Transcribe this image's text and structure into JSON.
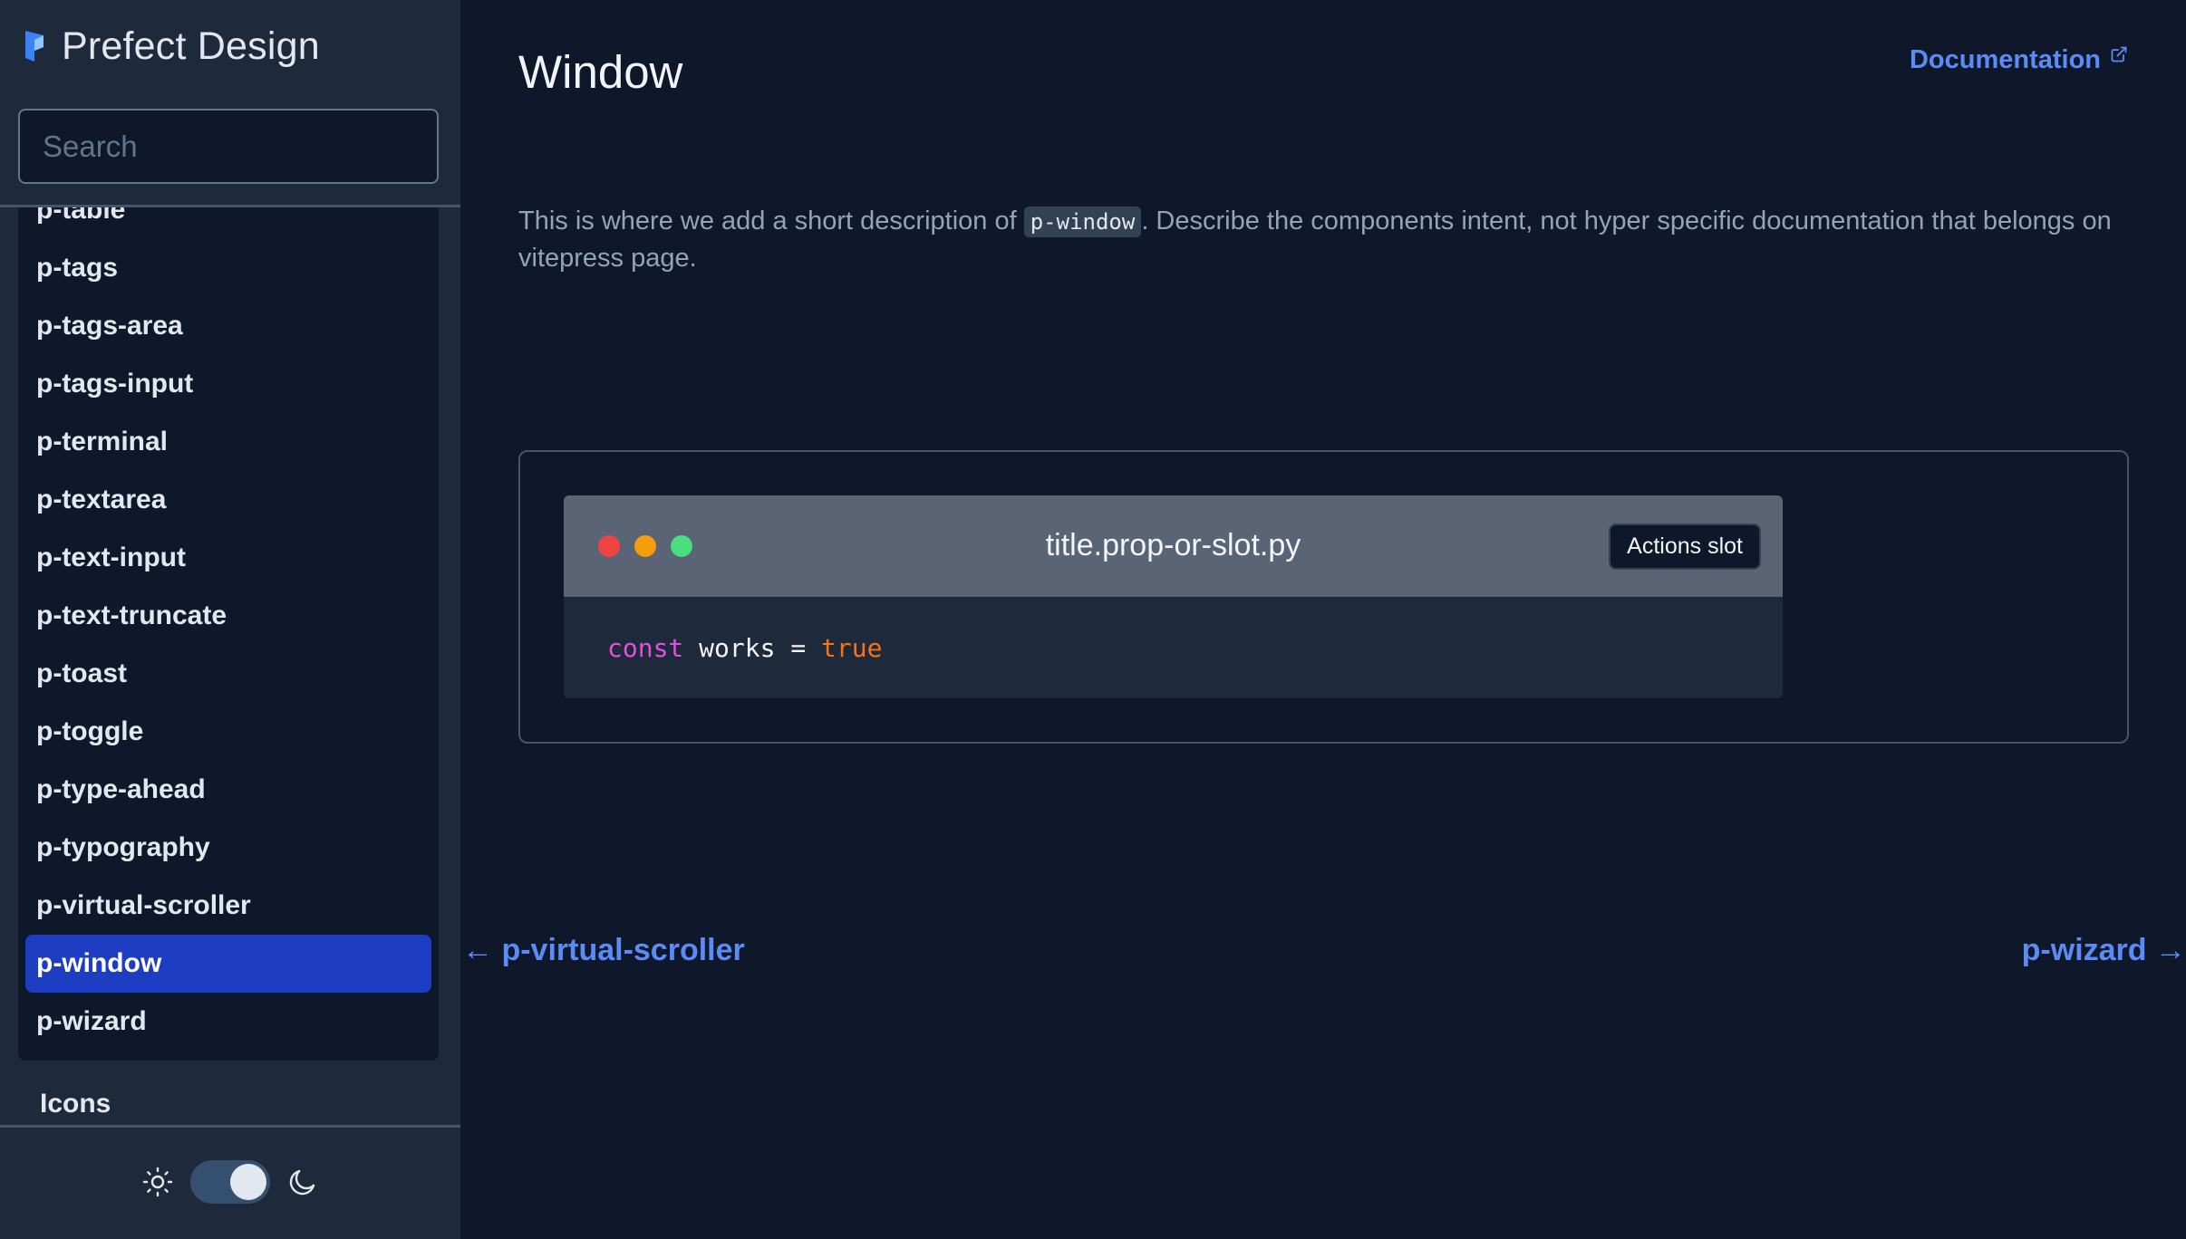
{
  "brand": {
    "title": "Prefect Design"
  },
  "search": {
    "placeholder": "Search"
  },
  "sidebar": {
    "items": [
      {
        "label": "p-table",
        "active": false
      },
      {
        "label": "p-tags",
        "active": false
      },
      {
        "label": "p-tags-area",
        "active": false
      },
      {
        "label": "p-tags-input",
        "active": false
      },
      {
        "label": "p-terminal",
        "active": false
      },
      {
        "label": "p-textarea",
        "active": false
      },
      {
        "label": "p-text-input",
        "active": false
      },
      {
        "label": "p-text-truncate",
        "active": false
      },
      {
        "label": "p-toast",
        "active": false
      },
      {
        "label": "p-toggle",
        "active": false
      },
      {
        "label": "p-type-ahead",
        "active": false
      },
      {
        "label": "p-typography",
        "active": false
      },
      {
        "label": "p-virtual-scroller",
        "active": false
      },
      {
        "label": "p-window",
        "active": true
      },
      {
        "label": "p-wizard",
        "active": false
      }
    ],
    "section_icons": "Icons",
    "theme": {
      "mode": "dark",
      "sun_icon": "sun-icon",
      "moon_icon": "moon-icon"
    }
  },
  "main": {
    "title": "Window",
    "doc_link": "Documentation",
    "description": {
      "before": "This is where we add a short description of ",
      "code": "p-window",
      "after": ". Describe the components intent, not hyper specific documentation that belongs on vitepress page."
    },
    "demo": {
      "window_title": "title.prop-or-slot.py",
      "actions_label": "Actions slot",
      "code": {
        "kw": "const",
        "ident": "works",
        "op": "=",
        "value": "true"
      }
    },
    "pager": {
      "prev": "← p-virtual-scroller",
      "next": "p-wizard →"
    }
  },
  "colors": {
    "background": "#0f172a",
    "sidebar": "#1e293b",
    "accent": "#5b8cf5",
    "active_item": "#1d3ec2"
  }
}
